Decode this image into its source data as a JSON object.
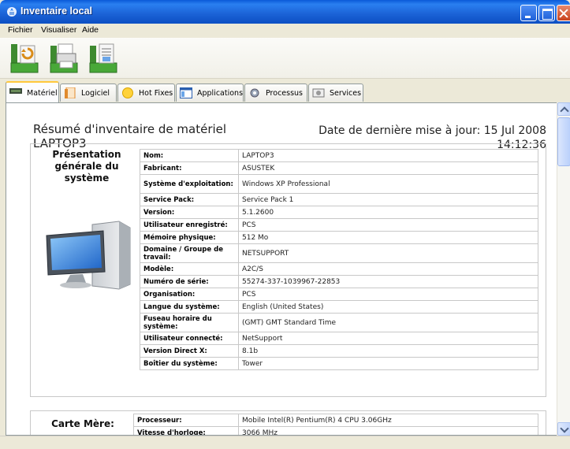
{
  "window": {
    "title": "Inventaire local"
  },
  "menu": {
    "items": [
      "Fichier",
      "Visualiser",
      "Aide"
    ]
  },
  "toolbar": {
    "buttons": [
      "refresh-inventory",
      "print-preview",
      "print"
    ]
  },
  "tabs": [
    {
      "label": "Matériel",
      "icon": "hardware-icon",
      "active": true
    },
    {
      "label": "Logiciel",
      "icon": "software-icon",
      "active": false
    },
    {
      "label": "Hot Fixes",
      "icon": "hotfix-icon",
      "active": false
    },
    {
      "label": "Applications",
      "icon": "applications-icon",
      "active": false
    },
    {
      "label": "Processus",
      "icon": "processes-icon",
      "active": false
    },
    {
      "label": "Services",
      "icon": "services-icon",
      "active": false
    }
  ],
  "report": {
    "title_line1": "Résumé d'inventaire de matériel",
    "title_line2": "LAPTOP3",
    "date_line1": "Date de dernière mise à jour: 15 Jul 2008",
    "date_line2": "14:12:36"
  },
  "system_section": {
    "label": "Présentation générale du système",
    "rows": [
      {
        "key": "Nom:",
        "value": "LAPTOP3"
      },
      {
        "key": "Fabricant:",
        "value": "ASUSTEK"
      },
      {
        "key": "Système d'exploitation:",
        "value": "Windows XP Professional"
      },
      {
        "key": "Service Pack:",
        "value": "Service Pack 1"
      },
      {
        "key": "Version:",
        "value": "5.1.2600"
      },
      {
        "key": "Utilisateur enregistré:",
        "value": "PCS"
      },
      {
        "key": "Mémoire physique:",
        "value": "512 Mo"
      },
      {
        "key": "Domaine / Groupe de travail:",
        "value": "NETSUPPORT"
      },
      {
        "key": "Modèle:",
        "value": "A2C/S"
      },
      {
        "key": "Numéro de série:",
        "value": "55274-337-1039967-22853"
      },
      {
        "key": "Organisation:",
        "value": "PCS"
      },
      {
        "key": "Langue du système:",
        "value": "English (United States)"
      },
      {
        "key": "Fuseau horaire du système:",
        "value": "(GMT) GMT Standard Time"
      },
      {
        "key": "Utilisateur connecté:",
        "value": "NetSupport"
      },
      {
        "key": "Version Direct X:",
        "value": "8.1b"
      },
      {
        "key": "Boîtier du système:",
        "value": "Tower"
      }
    ]
  },
  "motherboard_section": {
    "label": "Carte Mère:",
    "rows": [
      {
        "key": "Processeur:",
        "value": "Mobile Intel(R) Pentium(R) 4 CPU 3.06GHz"
      },
      {
        "key": "Vitesse d'horloge:",
        "value": "3066 MHz"
      }
    ]
  }
}
